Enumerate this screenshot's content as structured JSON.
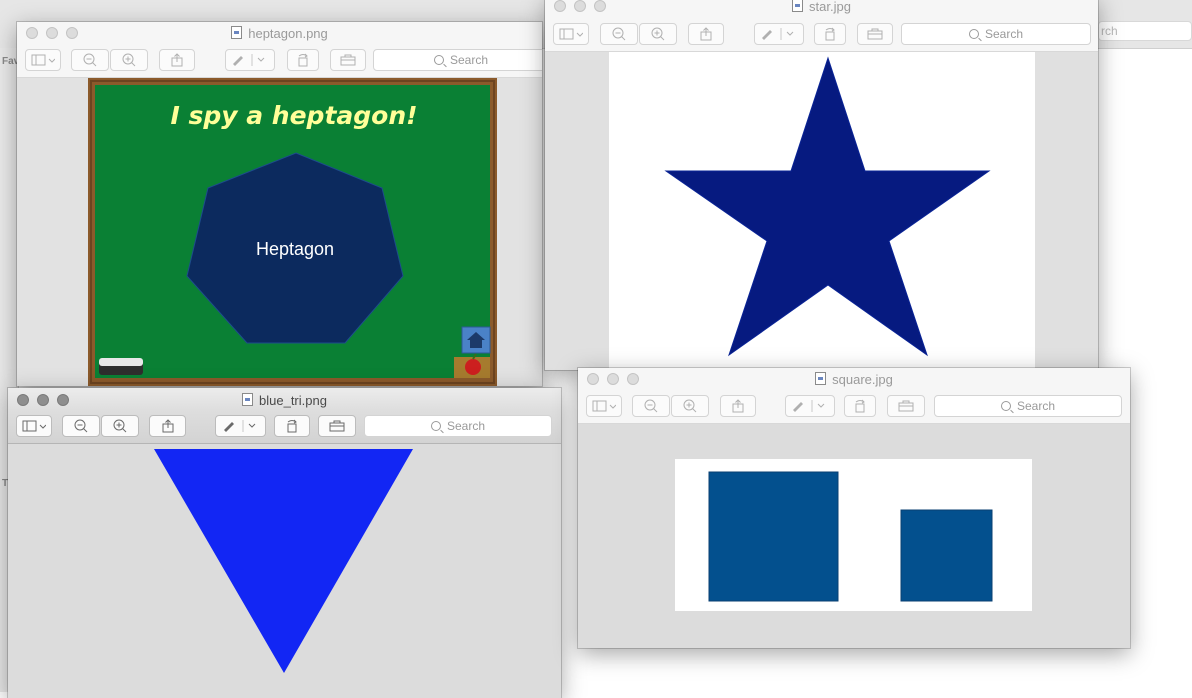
{
  "bg_window": {
    "search_placeholder": "rch",
    "sidebar_label_favorites": "Fav",
    "sidebar_label_t": "T"
  },
  "toolbar": {
    "search_placeholder": "Search"
  },
  "windows": {
    "heptagon": {
      "title": "heptagon.png",
      "slide_title": "I spy a heptagon!",
      "shape_label": "Heptagon",
      "colors": {
        "board": "#0a8034",
        "frame": "#8b5a2b",
        "shape": "#0c2a5e",
        "title_text": "#ffff99"
      }
    },
    "star": {
      "title": "star.jpg",
      "colors": {
        "shape": "#061a80",
        "canvas": "#ffffff"
      }
    },
    "blue_tri": {
      "title": "blue_tri.png",
      "colors": {
        "shape": "#1226f4"
      }
    },
    "square": {
      "title": "square.jpg",
      "colors": {
        "shape": "#03508e",
        "canvas": "#ffffff"
      }
    }
  }
}
